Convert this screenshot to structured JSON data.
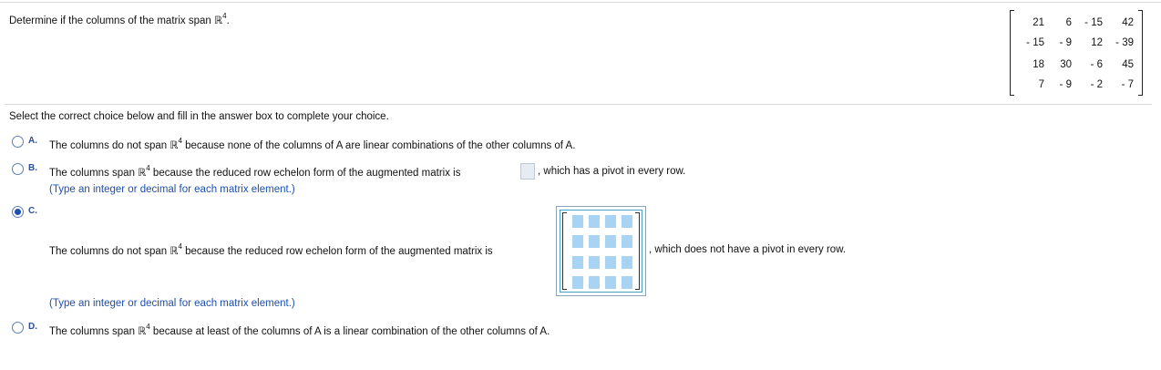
{
  "question": {
    "text_before": "Determine if the columns of the matrix span ",
    "space": "ℝ",
    "exponent": "4",
    "text_after": "."
  },
  "matrix": {
    "rows": [
      [
        "21",
        "6",
        "- 15",
        "42"
      ],
      [
        "- 15",
        "- 9",
        "12",
        "- 39"
      ],
      [
        "18",
        "30",
        "- 6",
        "45"
      ],
      [
        "7",
        "- 9",
        "- 2",
        "- 7"
      ]
    ]
  },
  "instruction": "Select the correct choice below and fill in the answer box to complete your choice.",
  "choices": [
    {
      "letter": "A.",
      "selected": false,
      "text_before": "The columns do not span ",
      "space": "ℝ",
      "exponent": "4",
      "text_after": " because none of the columns of A are linear combinations of the other columns of A."
    },
    {
      "letter": "B.",
      "selected": false,
      "text_before": "The columns span ",
      "space": "ℝ",
      "exponent": "4",
      "text_mid": " because the reduced row echelon form of the augmented matrix is ",
      "text_after": ", which has a pivot in every row.",
      "hint": "(Type an integer or decimal for each matrix element.)"
    },
    {
      "letter": "C.",
      "selected": true,
      "text_before": "The columns do not span ",
      "space": "ℝ",
      "exponent": "4",
      "text_mid": " because the reduced row echelon form of the augmented matrix is ",
      "text_after": ", which does not have a pivot in every row.",
      "hint": "(Type an integer or decimal for each matrix element.)"
    },
    {
      "letter": "D.",
      "selected": false,
      "text_before": "The columns span ",
      "space": "ℝ",
      "exponent": "4",
      "text_after": " because at least of the columns of A is a linear combination of the other columns of A."
    }
  ]
}
